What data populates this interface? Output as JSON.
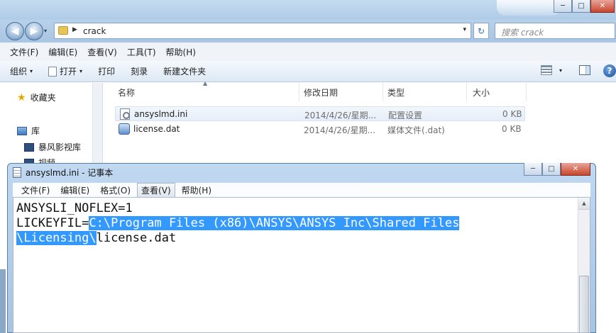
{
  "explorer": {
    "caption_buttons": {
      "minimize": "─",
      "maximize": "□",
      "close": "✕"
    },
    "address": {
      "back_icon": "◀",
      "forward_icon": "▶",
      "separator": "▶",
      "path": "crack",
      "dropdown": "▾",
      "refresh": "↻"
    },
    "search": {
      "placeholder": "搜索 crack"
    },
    "menu": [
      "文件(F)",
      "编辑(E)",
      "查看(V)",
      "工具(T)",
      "帮助(H)"
    ],
    "toolbar": {
      "organize": "组织",
      "open": "打开",
      "print": "打印",
      "burn": "刻录",
      "new_folder": "新建文件夹",
      "dropdown": "▾",
      "help": "?"
    },
    "nav": {
      "favorites": "收藏夹",
      "libraries": "库",
      "storm_video": "暴风影视库",
      "videos": "视频"
    },
    "columns": {
      "name": "名称",
      "modified": "修改日期",
      "type": "类型",
      "size": "大小",
      "sort_indicator": "▲"
    },
    "files": [
      {
        "name": "ansyslmd.ini",
        "modified": "2014/4/26/星期...",
        "type": "配置设置",
        "size": "0 KB"
      },
      {
        "name": "license.dat",
        "modified": "2014/4/26/星期...",
        "type": "媒体文件(.dat)",
        "size": "0 KB"
      }
    ]
  },
  "notepad": {
    "title": "ansyslmd.ini - 记事本",
    "caption_buttons": {
      "minimize": "─",
      "maximize": "□",
      "close": "✕"
    },
    "menu": [
      "文件(F)",
      "编辑(E)",
      "格式(O)",
      "查看(V)",
      "帮助(H)"
    ],
    "lines": {
      "line1": "ANSYSLI_NOFLEX=1",
      "line2_prefix": "LICKEYFIL=",
      "line2_selected": "C:\\Program Files (x86)\\ANSYS\\ANSYS Inc\\Shared Files",
      "line3_selected": "\\Licensing\\",
      "line3_rest": "license.dat"
    },
    "scroll_up": "▲"
  },
  "colors": {
    "selection": "#3399ff",
    "titlebar": "#b3cfe9"
  }
}
